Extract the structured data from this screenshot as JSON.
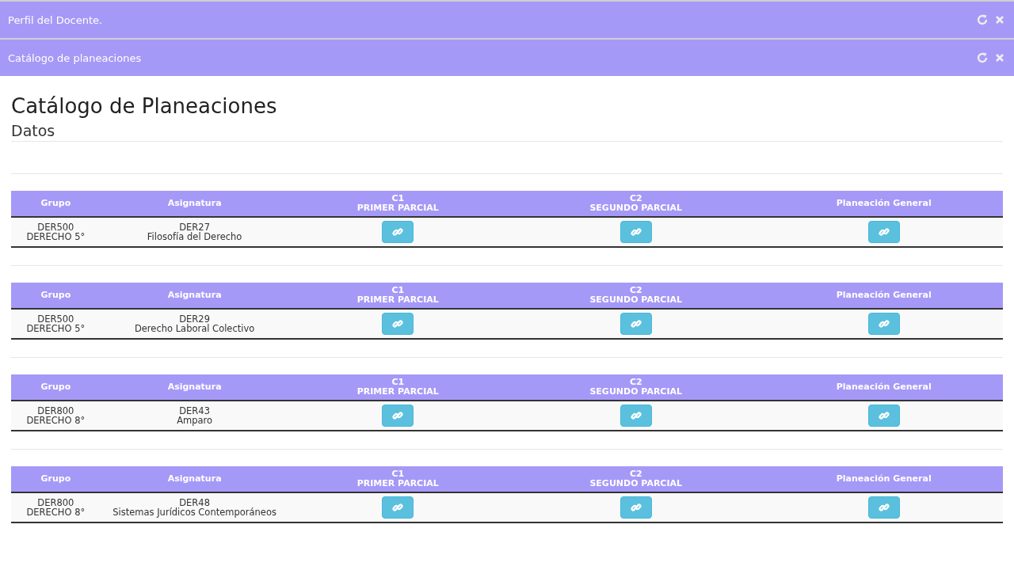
{
  "panels": [
    {
      "title": "Perfil del Docente."
    },
    {
      "title": "Catálogo de planeaciones"
    }
  ],
  "page": {
    "heading": "Catálogo de Planeaciones",
    "subheading": "Datos"
  },
  "tables": [
    {
      "columns": [
        "Grupo",
        "Asignatura",
        "C1\nPRIMER PARCIAL",
        "C2\nSEGUNDO PARCIAL",
        "Planeación General"
      ],
      "grupo": [
        "DER500",
        "DERECHO 5°"
      ],
      "asignatura": [
        "DER27",
        "Filosofía del Derecho"
      ]
    },
    {
      "columns": [
        "Grupo",
        "Asignatura",
        "C1\nPRIMER PARCIAL",
        "C2\nSEGUNDO PARCIAL",
        "Planeación General"
      ],
      "grupo": [
        "DER500",
        "DERECHO 5°"
      ],
      "asignatura": [
        "DER29",
        "Derecho Laboral Colectivo"
      ]
    },
    {
      "columns": [
        "Grupo",
        "Asignatura",
        "C1\nPRIMER PARCIAL",
        "C2\nSEGUNDO PARCIAL",
        "Planeación General"
      ],
      "grupo": [
        "DER800",
        "DERECHO 8°"
      ],
      "asignatura": [
        "DER43",
        "Amparo"
      ]
    },
    {
      "columns": [
        "Grupo",
        "Asignatura",
        "C1\nPRIMER PARCIAL",
        "C2\nSEGUNDO PARCIAL",
        "Planeación General"
      ],
      "grupo": [
        "DER800",
        "DERECHO 8°"
      ],
      "asignatura": [
        "DER48",
        "Sistemas Jurídicos Contemporáneos"
      ]
    }
  ]
}
